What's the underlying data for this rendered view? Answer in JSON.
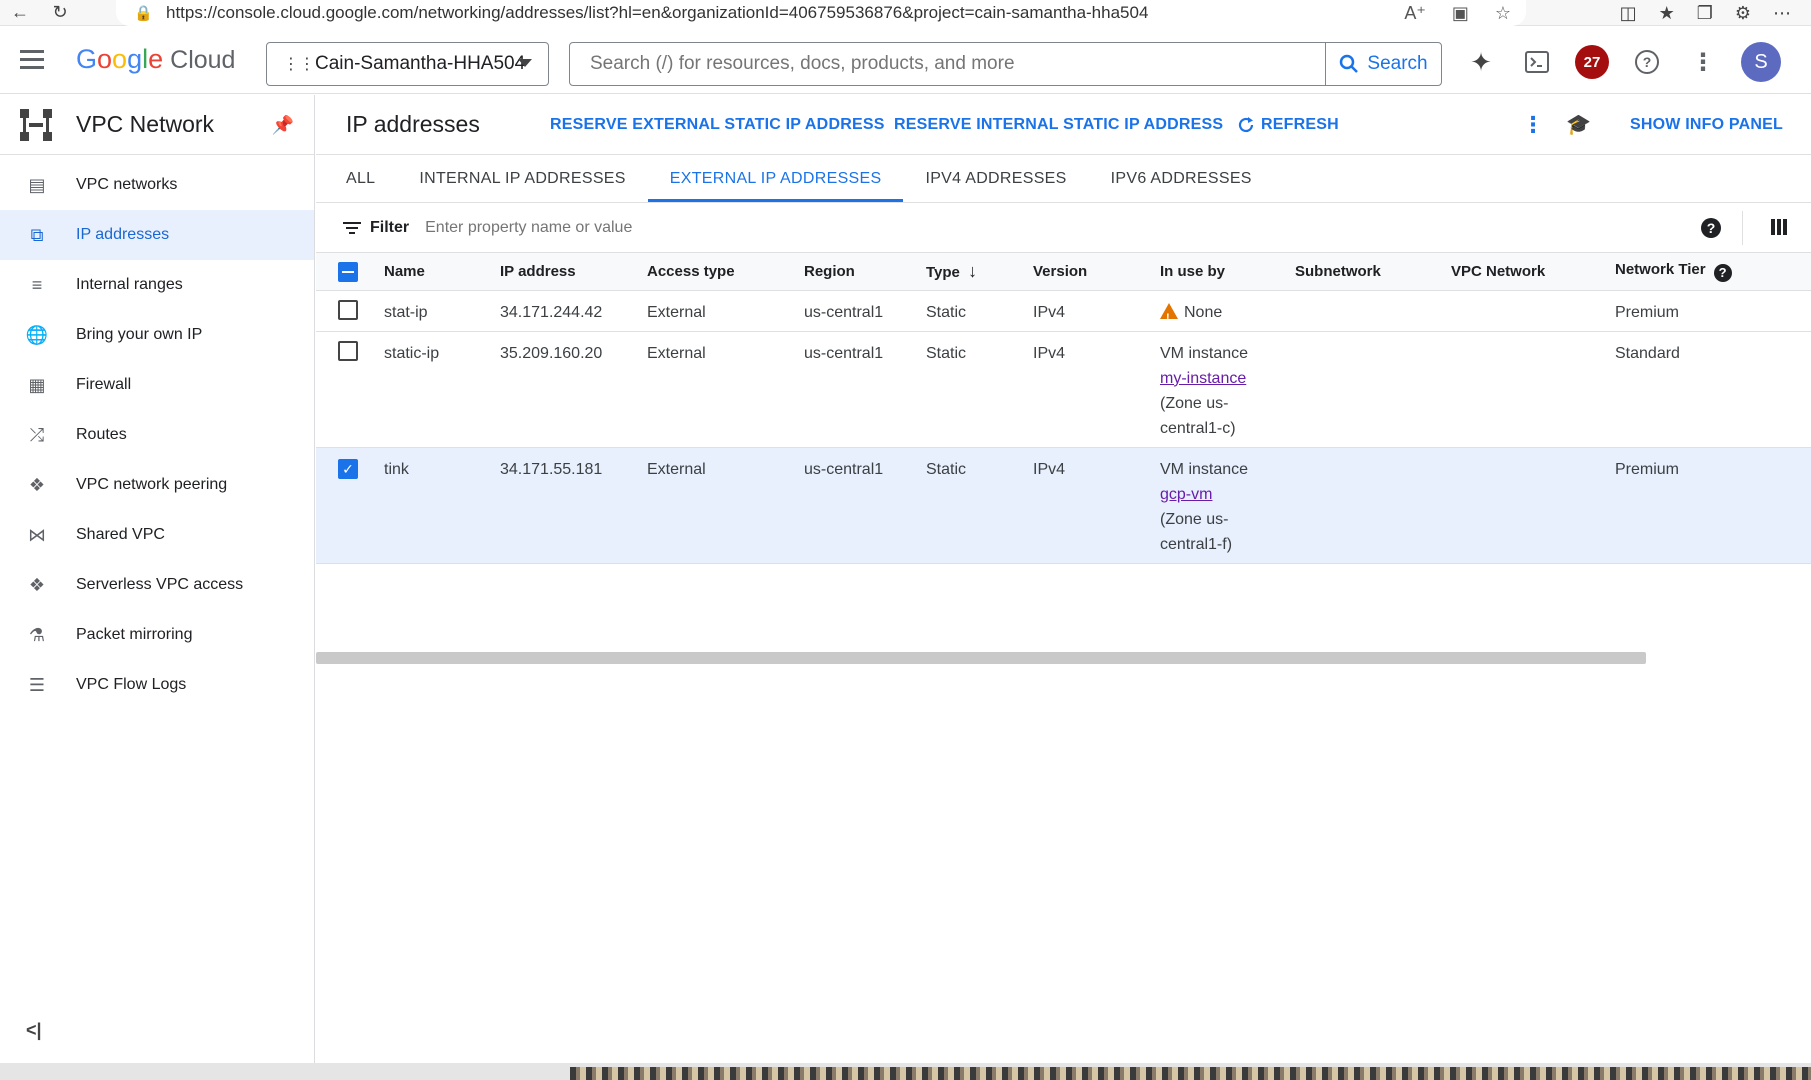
{
  "browser": {
    "url": "https://console.cloud.google.com/networking/addresses/list?hl=en&organizationId=406759536876&project=cain-samantha-hha504"
  },
  "header": {
    "logo_google": "Google",
    "logo_cloud": "Cloud",
    "project": "Cain-Samantha-HHA504",
    "search_placeholder": "Search (/) for resources, docs, products, and more",
    "search_button": "Search",
    "notification_count": "27",
    "avatar_letter": "S"
  },
  "sidebar": {
    "title": "VPC Network",
    "items": [
      {
        "label": "VPC networks",
        "icon": "vpc-networks-icon"
      },
      {
        "label": "IP addresses",
        "icon": "ip-addresses-icon"
      },
      {
        "label": "Internal ranges",
        "icon": "internal-ranges-icon"
      },
      {
        "label": "Bring your own IP",
        "icon": "globe-icon"
      },
      {
        "label": "Firewall",
        "icon": "firewall-icon"
      },
      {
        "label": "Routes",
        "icon": "routes-icon"
      },
      {
        "label": "VPC network peering",
        "icon": "peering-icon"
      },
      {
        "label": "Shared VPC",
        "icon": "shared-vpc-icon"
      },
      {
        "label": "Serverless VPC access",
        "icon": "serverless-icon"
      },
      {
        "label": "Packet mirroring",
        "icon": "packet-mirroring-icon"
      },
      {
        "label": "VPC Flow Logs",
        "icon": "flow-logs-icon"
      }
    ],
    "active_index": 1
  },
  "page": {
    "title": "IP addresses",
    "actions": {
      "reserve_external": "RESERVE EXTERNAL STATIC IP ADDRESS",
      "reserve_internal": "RESERVE INTERNAL STATIC IP ADDRESS",
      "refresh": "REFRESH",
      "show_info": "SHOW INFO PANEL"
    },
    "tabs": [
      "ALL",
      "INTERNAL IP ADDRESSES",
      "EXTERNAL IP ADDRESSES",
      "IPV4 ADDRESSES",
      "IPV6 ADDRESSES"
    ],
    "active_tab": 2,
    "filter_label": "Filter",
    "filter_placeholder": "Enter property name or value"
  },
  "table": {
    "columns": [
      "Name",
      "IP address",
      "Access type",
      "Region",
      "Type",
      "Version",
      "In use by",
      "Subnetwork",
      "VPC Network",
      "Network Tier"
    ],
    "rows": [
      {
        "name": "stat-ip",
        "ip": "34.171.244.42",
        "access": "External",
        "region": "us-central1",
        "type": "Static",
        "version": "IPv4",
        "in_use_text": "None",
        "in_use_link": "",
        "in_use_zone": "",
        "subnetwork": "",
        "vpc": "",
        "tier": "Premium",
        "selected": false
      },
      {
        "name": "static-ip",
        "ip": "35.209.160.20",
        "access": "External",
        "region": "us-central1",
        "type": "Static",
        "version": "IPv4",
        "in_use_text": "VM instance",
        "in_use_link": "my-instance",
        "in_use_zone": "(Zone us-central1-c)",
        "subnetwork": "",
        "vpc": "",
        "tier": "Standard",
        "selected": false
      },
      {
        "name": "tink",
        "ip": "34.171.55.181",
        "access": "External",
        "region": "us-central1",
        "type": "Static",
        "version": "IPv4",
        "in_use_text": "VM instance",
        "in_use_link": "gcp-vm",
        "in_use_zone": "(Zone us-central1-f)",
        "subnetwork": "",
        "vpc": "",
        "tier": "Premium",
        "selected": true
      }
    ]
  }
}
